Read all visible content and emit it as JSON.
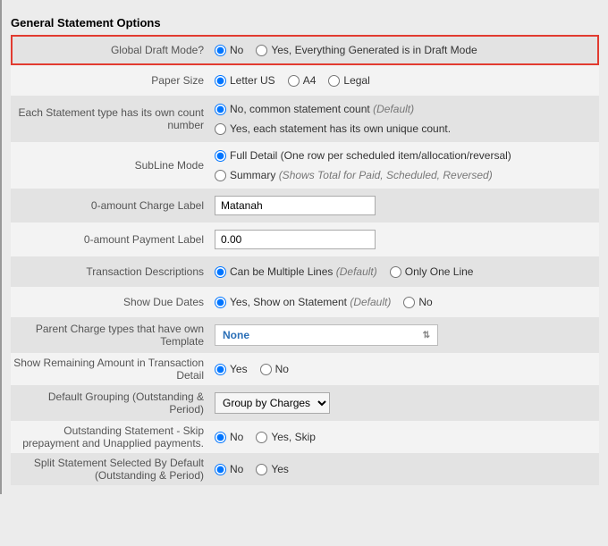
{
  "section_title": "General Statement Options",
  "rows": {
    "global_draft": {
      "label": "Global Draft Mode?",
      "opt_no": "No",
      "opt_yes": "Yes, Everything Generated is in Draft Mode"
    },
    "paper_size": {
      "label": "Paper Size",
      "opt_letter": "Letter US",
      "opt_a4": "A4",
      "opt_legal": "Legal"
    },
    "count_number": {
      "label": "Each Statement type has its own count number",
      "opt_no_a": "No, common statement count",
      "opt_no_b": "(Default)",
      "opt_yes": "Yes, each statement has its own unique count."
    },
    "subline": {
      "label": "SubLine Mode",
      "opt_full": "Full Detail (One row per scheduled item/allocation/reversal)",
      "opt_sum_a": "Summary",
      "opt_sum_b": "(Shows Total for Paid, Scheduled, Reversed)"
    },
    "zero_charge": {
      "label": "0-amount Charge Label",
      "value": "Matanah"
    },
    "zero_payment": {
      "label": "0-amount Payment Label",
      "value": "0.00"
    },
    "trans_desc": {
      "label": "Transaction Descriptions",
      "opt_multi_a": "Can be Multiple Lines",
      "opt_multi_b": "(Default)",
      "opt_one": "Only One Line"
    },
    "due_dates": {
      "label": "Show Due Dates",
      "opt_yes_a": "Yes, Show on Statement",
      "opt_yes_b": "(Default)",
      "opt_no": "No"
    },
    "parent_template": {
      "label": "Parent Charge types that have own Template",
      "value": "None"
    },
    "remaining": {
      "label": "Show Remaining Amount in Transaction Detail",
      "opt_yes": "Yes",
      "opt_no": "No"
    },
    "grouping": {
      "label": "Default Grouping (Outstanding & Period)",
      "value": "Group by Charges"
    },
    "skip_prepay": {
      "label": "Outstanding Statement - Skip prepayment and Unapplied payments.",
      "opt_no": "No",
      "opt_yes": "Yes, Skip"
    },
    "split_default": {
      "label": "Split Statement Selected By Default (Outstanding & Period)",
      "opt_no": "No",
      "opt_yes": "Yes"
    }
  }
}
